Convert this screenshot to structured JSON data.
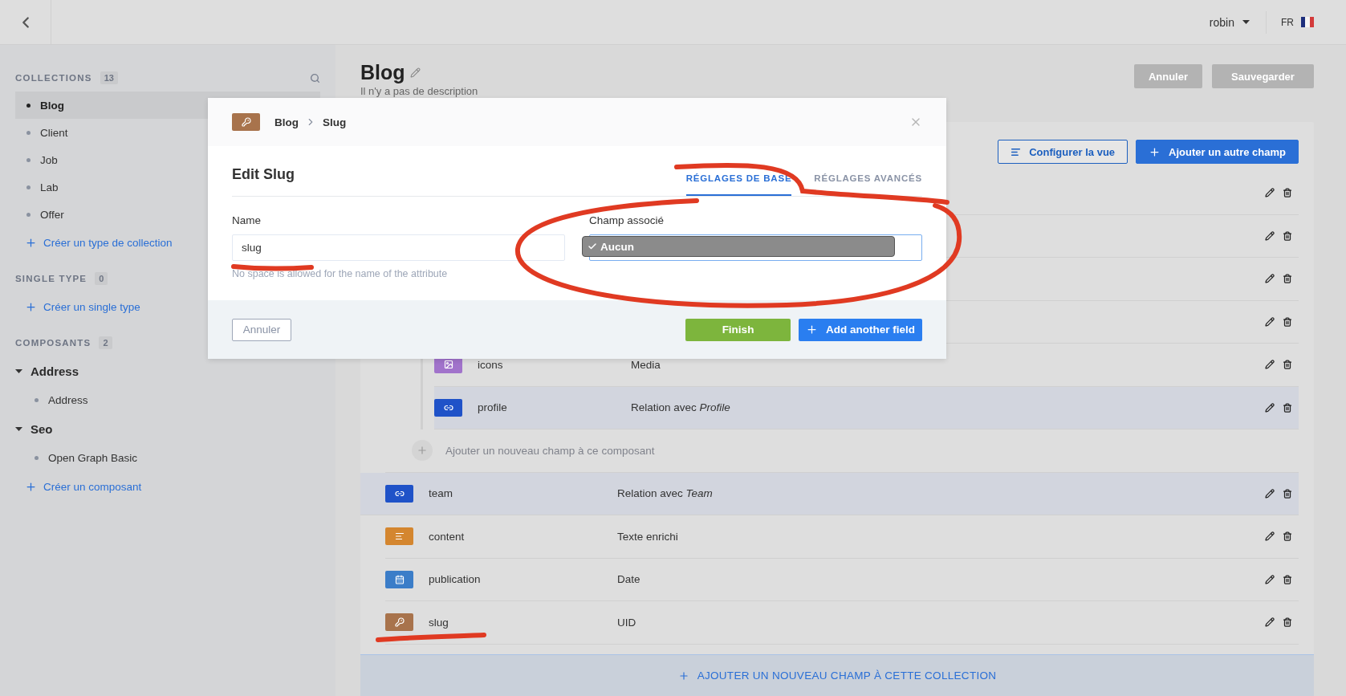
{
  "top_bar": {
    "user": "robin",
    "language": "FR"
  },
  "sidebar": {
    "sections": [
      {
        "kind": "list",
        "title": "COLLECTIONS",
        "count": "13",
        "search": true,
        "items": [
          {
            "label": "Blog",
            "selected": true
          },
          {
            "label": "Client",
            "selected": false
          },
          {
            "label": "Job",
            "selected": false
          },
          {
            "label": "Lab",
            "selected": false
          },
          {
            "label": "Offer",
            "selected": false
          }
        ],
        "link": "Créer un type de collection"
      },
      {
        "kind": "list",
        "title": "SINGLE TYPE",
        "count": "0",
        "link": "Créer un single type"
      },
      {
        "kind": "tree",
        "title": "COMPOSANTS",
        "count": "2",
        "groups": [
          {
            "label": "Address",
            "expanded": true,
            "children": [
              {
                "label": "Address"
              }
            ]
          },
          {
            "label": "Seo",
            "expanded": true,
            "children": [
              {
                "label": "Open Graph Basic"
              }
            ]
          }
        ],
        "link": "Créer un composant"
      }
    ]
  },
  "page": {
    "title": "Blog",
    "description": "Il n'y a pas de description",
    "buttons": [
      {
        "label": "Annuler",
        "disabled": true
      },
      {
        "label": "Sauvegarder",
        "disabled": true
      }
    ]
  },
  "fields": {
    "actions": [
      {
        "kind": "outline",
        "label": "Configurer la vue"
      },
      {
        "kind": "primary",
        "label": "Ajouter un autre champ"
      }
    ],
    "rows": [
      {
        "kind": "hidden"
      },
      {
        "kind": "hidden"
      },
      {
        "kind": "hidden"
      },
      {
        "kind": "hidden",
        "children": [
          {
            "kind": "media",
            "name": "icons",
            "type": "Media",
            "highlighted": false
          },
          {
            "kind": "relation",
            "name": "profile",
            "type": "Relation avec *Profile*",
            "highlighted": true
          },
          {
            "kind": "add",
            "label": "Ajouter un nouveau champ à ce composant"
          }
        ]
      },
      {
        "kind": "relation",
        "name": "team",
        "type": "Relation avec *Team*",
        "highlighted": true
      },
      {
        "kind": "richtext",
        "name": "content",
        "type": "Texte enrichi",
        "highlighted": false
      },
      {
        "kind": "date",
        "name": "publication",
        "type": "Date",
        "highlighted": false
      },
      {
        "kind": "uid",
        "name": "slug",
        "type": "UID",
        "highlighted": false
      }
    ],
    "add_link": "AJOUTER UN NOUVEAU CHAMP À CETTE COLLECTION"
  },
  "modal": {
    "kind": "uid",
    "breadcrumb": [
      "Blog",
      "Slug"
    ],
    "title": "Edit Slug",
    "tabs": [
      {
        "label": "RÉGLAGES DE BASE",
        "selected": true
      },
      {
        "label": "RÉGLAGES AVANCÉS",
        "selected": false
      }
    ],
    "name_field": {
      "label": "Name",
      "value": "slug",
      "hint": "No space is allowed for the name of the attribute"
    },
    "select_field": {
      "label": "Champ associé",
      "options": [
        {
          "label": "Aucun",
          "selected": true
        }
      ]
    },
    "buttons": [
      {
        "kind": "cancel",
        "label": "Annuler"
      },
      {
        "kind": "finish",
        "label": "Finish"
      },
      {
        "kind": "add",
        "label": "Add another field"
      }
    ]
  },
  "annotations": [
    {
      "kind": "stroke"
    },
    {
      "kind": "loop"
    },
    {
      "kind": "underline"
    },
    {
      "kind": "underline"
    }
  ]
}
